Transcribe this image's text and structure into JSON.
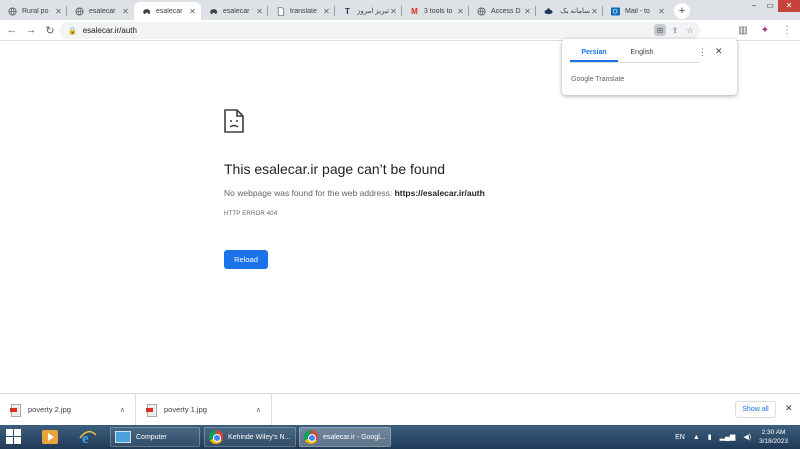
{
  "tabs": [
    {
      "title": "Rural po",
      "icon": "globe-icon",
      "active": false
    },
    {
      "title": "esalecar",
      "icon": "globe-icon",
      "active": false
    },
    {
      "title": "esalecar",
      "icon": "car-icon",
      "active": true
    },
    {
      "title": "esalecar",
      "icon": "car-icon",
      "active": false
    },
    {
      "title": "translate",
      "icon": "document-icon",
      "active": false
    },
    {
      "title": "تبریز امروز",
      "icon": "tabriz-icon",
      "active": false
    },
    {
      "title": "3 tools to",
      "icon": "gmail-icon",
      "active": false
    },
    {
      "title": "Access D",
      "icon": "globe-icon",
      "active": false
    },
    {
      "title": "سامانه یک",
      "icon": "portal-icon",
      "active": false
    },
    {
      "title": "Mail - to",
      "icon": "outlook-icon",
      "active": false
    }
  ],
  "address_bar": {
    "url": "esalecar.ir/auth"
  },
  "translate_popup": {
    "tab_source": "Persian",
    "tab_target": "English",
    "footer": "Google Translate"
  },
  "error_page": {
    "title": "This esalecar.ir page can’t be found",
    "desc_prefix": "No webpage was found for the web address: ",
    "desc_url": "https://esalecar.ir/auth",
    "code": "HTTP ERROR 404",
    "reload_label": "Reload"
  },
  "downloads": {
    "items": [
      {
        "name": "poverty 2.jpg"
      },
      {
        "name": "poverty 1.jpg"
      }
    ],
    "show_all_label": "Show all"
  },
  "taskbar": {
    "items": [
      {
        "label": "Computer"
      },
      {
        "label": "Kehinde Wiley's N..."
      },
      {
        "label": "esalecar.ir - Googl..."
      }
    ],
    "language": "EN",
    "time": "2:30 AM",
    "date": "3/18/2023"
  },
  "colors": {
    "accent": "#1a73e8",
    "tabstrip": "#dee1e6",
    "taskbar": "#1f3a57"
  }
}
